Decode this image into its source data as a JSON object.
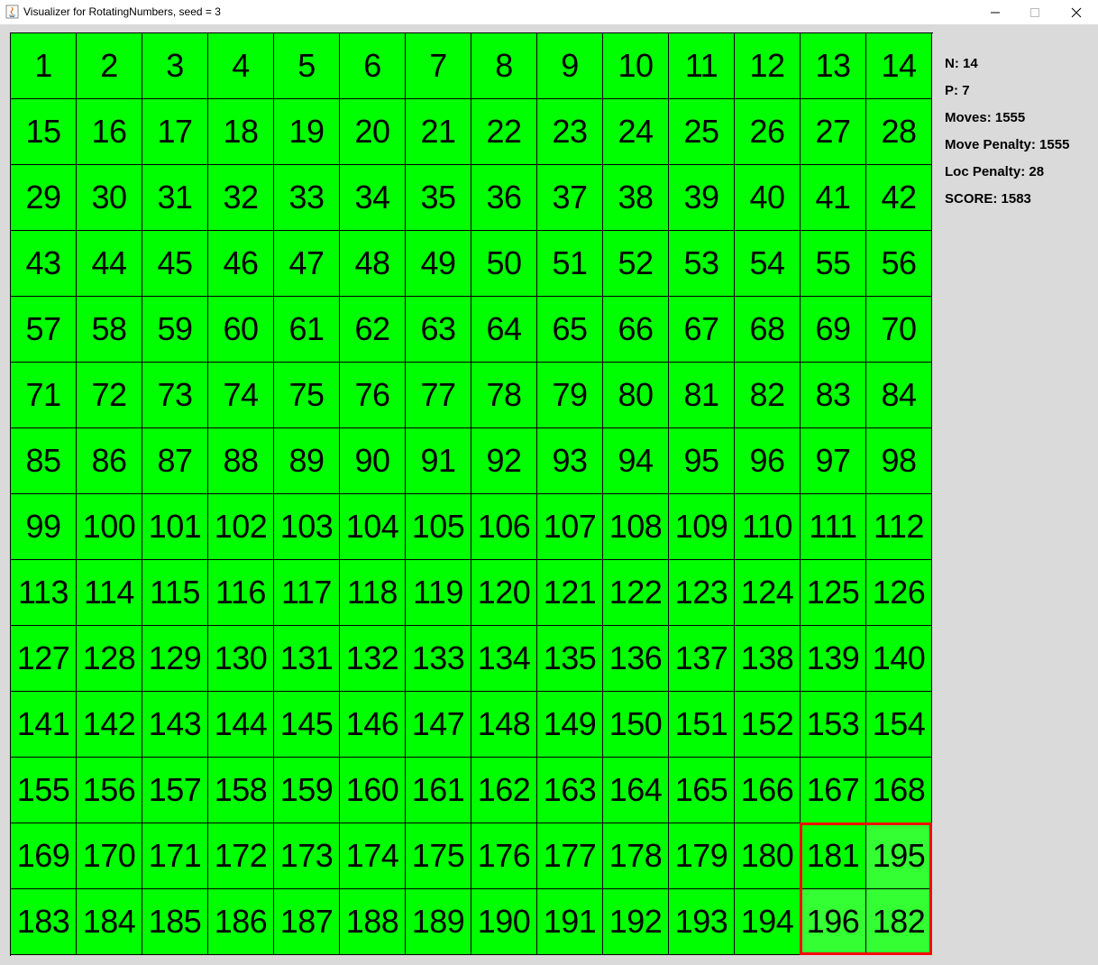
{
  "window": {
    "title": "Visualizer for RotatingNumbers, seed = 3",
    "icon": "java-icon",
    "controls": [
      "minimize-icon",
      "maximize-icon",
      "close-icon"
    ]
  },
  "colors": {
    "cell": "#00ff00",
    "cell_highlight": "#33ff33",
    "selection_border": "#ff0000",
    "panel_background": "#dadada"
  },
  "grid": {
    "size": 14,
    "rows": [
      [
        "1",
        "2",
        "3",
        "4",
        "5",
        "6",
        "7",
        "8",
        "9",
        "10",
        "11",
        "12",
        "13",
        "14"
      ],
      [
        "15",
        "16",
        "17",
        "18",
        "19",
        "20",
        "21",
        "22",
        "23",
        "24",
        "25",
        "26",
        "27",
        "28"
      ],
      [
        "29",
        "30",
        "31",
        "32",
        "33",
        "34",
        "35",
        "36",
        "37",
        "38",
        "39",
        "40",
        "41",
        "42"
      ],
      [
        "43",
        "44",
        "45",
        "46",
        "47",
        "48",
        "49",
        "50",
        "51",
        "52",
        "53",
        "54",
        "55",
        "56"
      ],
      [
        "57",
        "58",
        "59",
        "60",
        "61",
        "62",
        "63",
        "64",
        "65",
        "66",
        "67",
        "68",
        "69",
        "70"
      ],
      [
        "71",
        "72",
        "73",
        "74",
        "75",
        "76",
        "77",
        "78",
        "79",
        "80",
        "81",
        "82",
        "83",
        "84"
      ],
      [
        "85",
        "86",
        "87",
        "88",
        "89",
        "90",
        "91",
        "92",
        "93",
        "94",
        "95",
        "96",
        "97",
        "98"
      ],
      [
        "99",
        "100",
        "101",
        "102",
        "103",
        "104",
        "105",
        "106",
        "107",
        "108",
        "109",
        "110",
        "111",
        "112"
      ],
      [
        "113",
        "114",
        "115",
        "116",
        "117",
        "118",
        "119",
        "120",
        "121",
        "122",
        "123",
        "124",
        "125",
        "126"
      ],
      [
        "127",
        "128",
        "129",
        "130",
        "131",
        "132",
        "133",
        "134",
        "135",
        "136",
        "137",
        "138",
        "139",
        "140"
      ],
      [
        "141",
        "142",
        "143",
        "144",
        "145",
        "146",
        "147",
        "148",
        "149",
        "150",
        "151",
        "152",
        "153",
        "154"
      ],
      [
        "155",
        "156",
        "157",
        "158",
        "159",
        "160",
        "161",
        "162",
        "163",
        "164",
        "165",
        "166",
        "167",
        "168"
      ],
      [
        "169",
        "170",
        "171",
        "172",
        "173",
        "174",
        "175",
        "176",
        "177",
        "178",
        "179",
        "180",
        "181",
        "195"
      ],
      [
        "183",
        "184",
        "185",
        "186",
        "187",
        "188",
        "189",
        "190",
        "191",
        "192",
        "193",
        "194",
        "196",
        "182"
      ]
    ],
    "highlighted_cells": [
      [
        12,
        13
      ],
      [
        13,
        12
      ],
      [
        13,
        13
      ]
    ],
    "selection": {
      "row": 12,
      "col": 12,
      "size": 2
    }
  },
  "stats": [
    {
      "label": "N",
      "value": "14"
    },
    {
      "label": "P",
      "value": "7"
    },
    {
      "label": "Moves",
      "value": "1555"
    },
    {
      "label": "Move Penalty",
      "value": "1555"
    },
    {
      "label": "Loc Penalty",
      "value": "28"
    },
    {
      "label": "SCORE",
      "value": "1583"
    }
  ]
}
